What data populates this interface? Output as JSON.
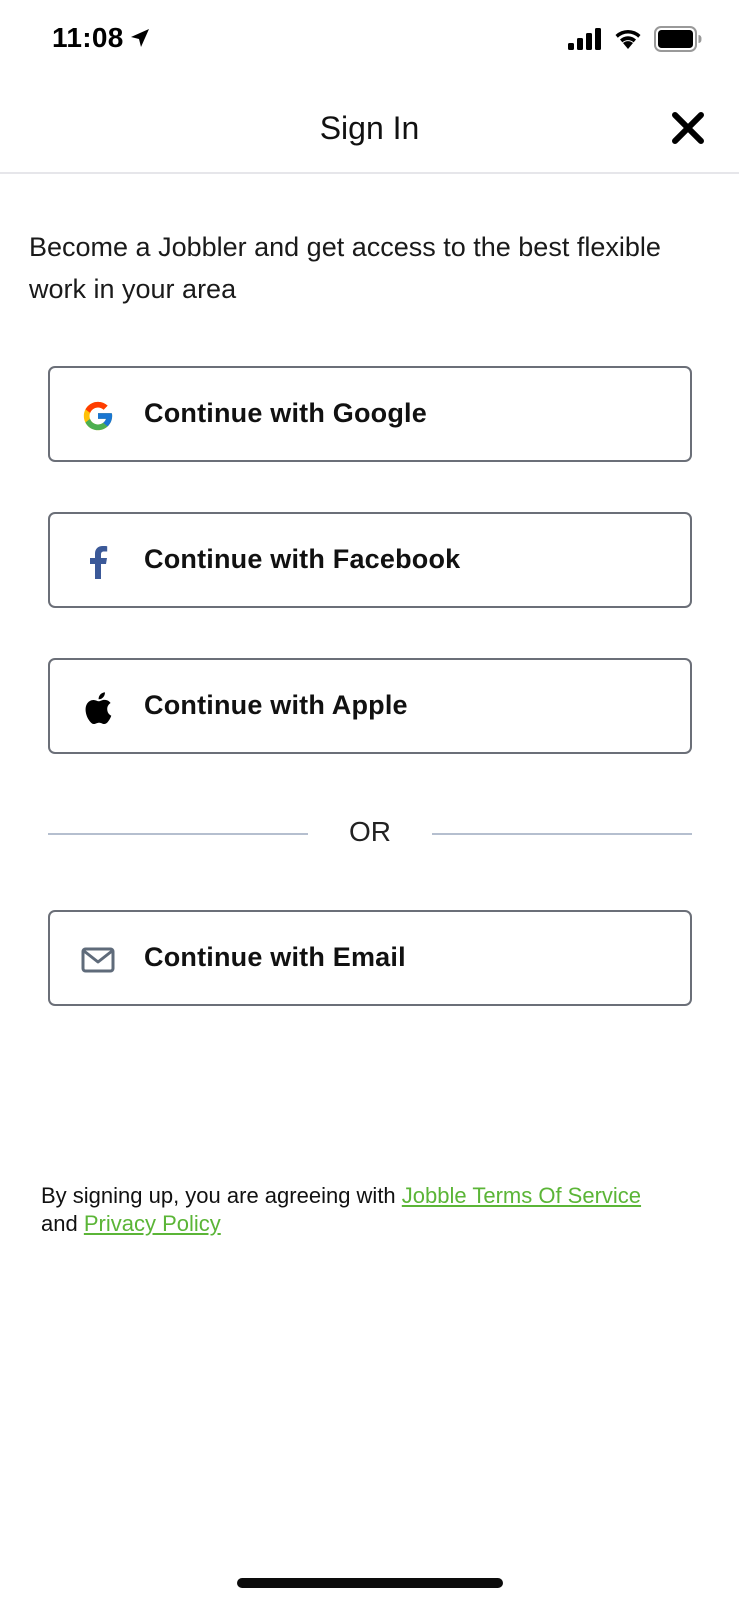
{
  "status_bar": {
    "time": "11:08",
    "icons": [
      "location-arrow-icon",
      "cellular-signal-icon",
      "wifi-icon",
      "battery-icon"
    ]
  },
  "header": {
    "title": "Sign In",
    "close_icon": "close-icon"
  },
  "intro_text": "Become a Jobbler and get access to the best flexible work in your area",
  "auth_buttons": {
    "google": {
      "label": "Continue with Google",
      "icon": "google-icon"
    },
    "facebook": {
      "label": "Continue with Facebook",
      "icon": "facebook-icon"
    },
    "apple": {
      "label": "Continue with Apple",
      "icon": "apple-icon"
    },
    "email": {
      "label": "Continue with Email",
      "icon": "mail-icon"
    }
  },
  "divider_text": "OR",
  "terms": {
    "prefix": "By signing up, you are agreeing with",
    "terms_link": "Jobble Terms Of Service",
    "connector": "and",
    "privacy_link": "Privacy Policy"
  },
  "colors": {
    "link": "#5bb537",
    "button_border": "#6b6f78",
    "divider": "#b5bfcf",
    "facebook": "#3b5998",
    "mail_icon": "#5f6b7a"
  }
}
